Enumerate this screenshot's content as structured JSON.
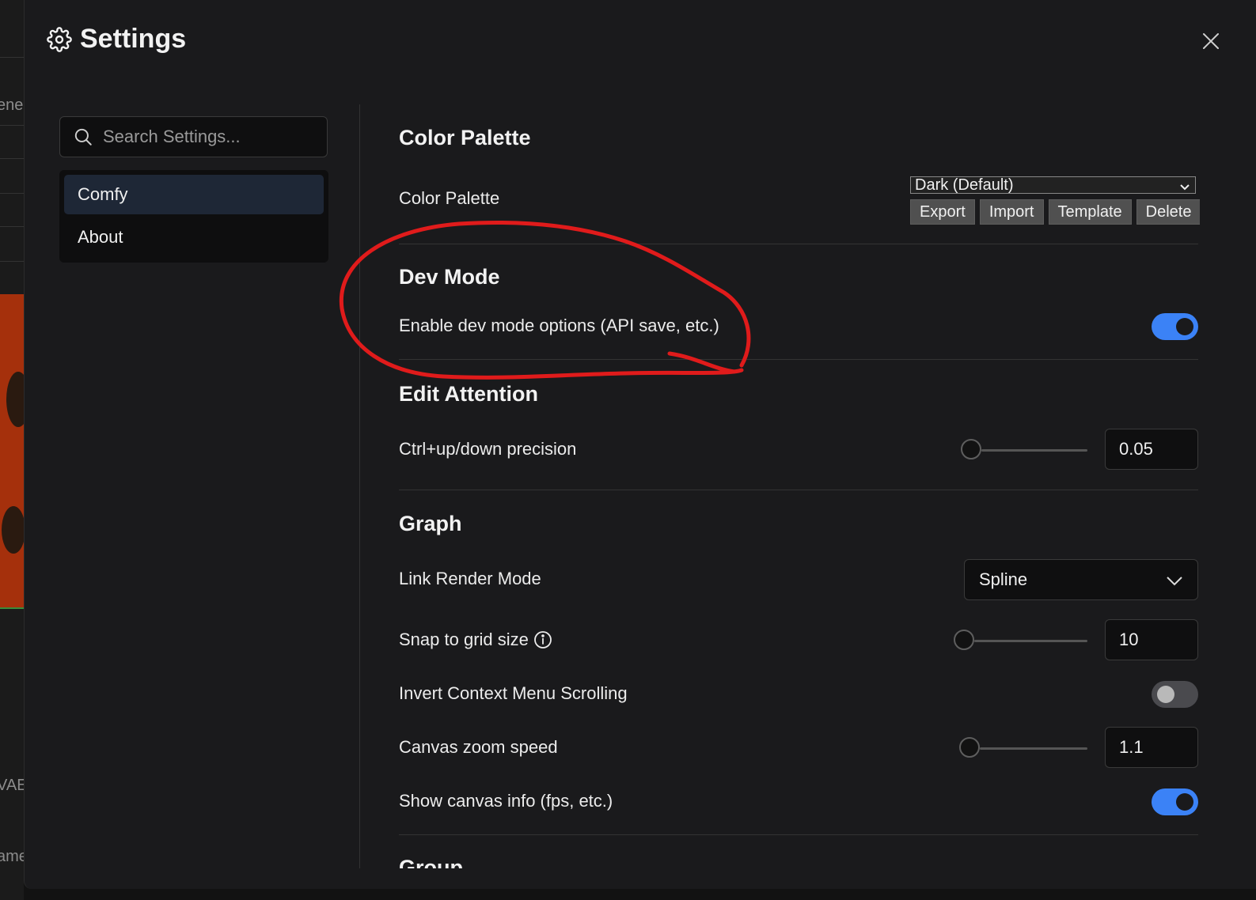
{
  "background": {
    "fragments": [
      "ene",
      "VAE",
      "ame"
    ]
  },
  "dialog": {
    "title": "Settings",
    "icons": {
      "title": "gear-icon",
      "close": "close-icon",
      "search": "search-icon"
    }
  },
  "search": {
    "placeholder": "Search Settings..."
  },
  "categories": [
    {
      "label": "Comfy",
      "active": true
    },
    {
      "label": "About",
      "active": false
    }
  ],
  "groups": {
    "color_palette": {
      "title": "Color Palette",
      "setting_label": "Color Palette",
      "selected": "Dark (Default)",
      "buttons": [
        "Export",
        "Import",
        "Template",
        "Delete"
      ]
    },
    "dev_mode": {
      "title": "Dev Mode",
      "setting_label": "Enable dev mode options (API save, etc.)",
      "enabled": true
    },
    "edit_attention": {
      "title": "Edit Attention",
      "setting_label": "Ctrl+up/down precision",
      "value": "0.05"
    },
    "graph": {
      "title": "Graph",
      "link_render_mode": {
        "label": "Link Render Mode",
        "value": "Spline"
      },
      "snap_to_grid": {
        "label": "Snap to grid size",
        "value": "10",
        "info_icon": "info-icon"
      },
      "invert_context_menu": {
        "label": "Invert Context Menu Scrolling",
        "enabled": false
      },
      "canvas_zoom_speed": {
        "label": "Canvas zoom speed",
        "value": "1.1"
      },
      "show_canvas_info": {
        "label": "Show canvas info (fps, etc.)",
        "enabled": true
      }
    },
    "group": {
      "title": "Group"
    }
  },
  "colors": {
    "accent": "#3b82f6",
    "annotation": "#e01b1b",
    "dialog_bg": "#1a1a1c",
    "active_category_bg": "#1e2736"
  }
}
